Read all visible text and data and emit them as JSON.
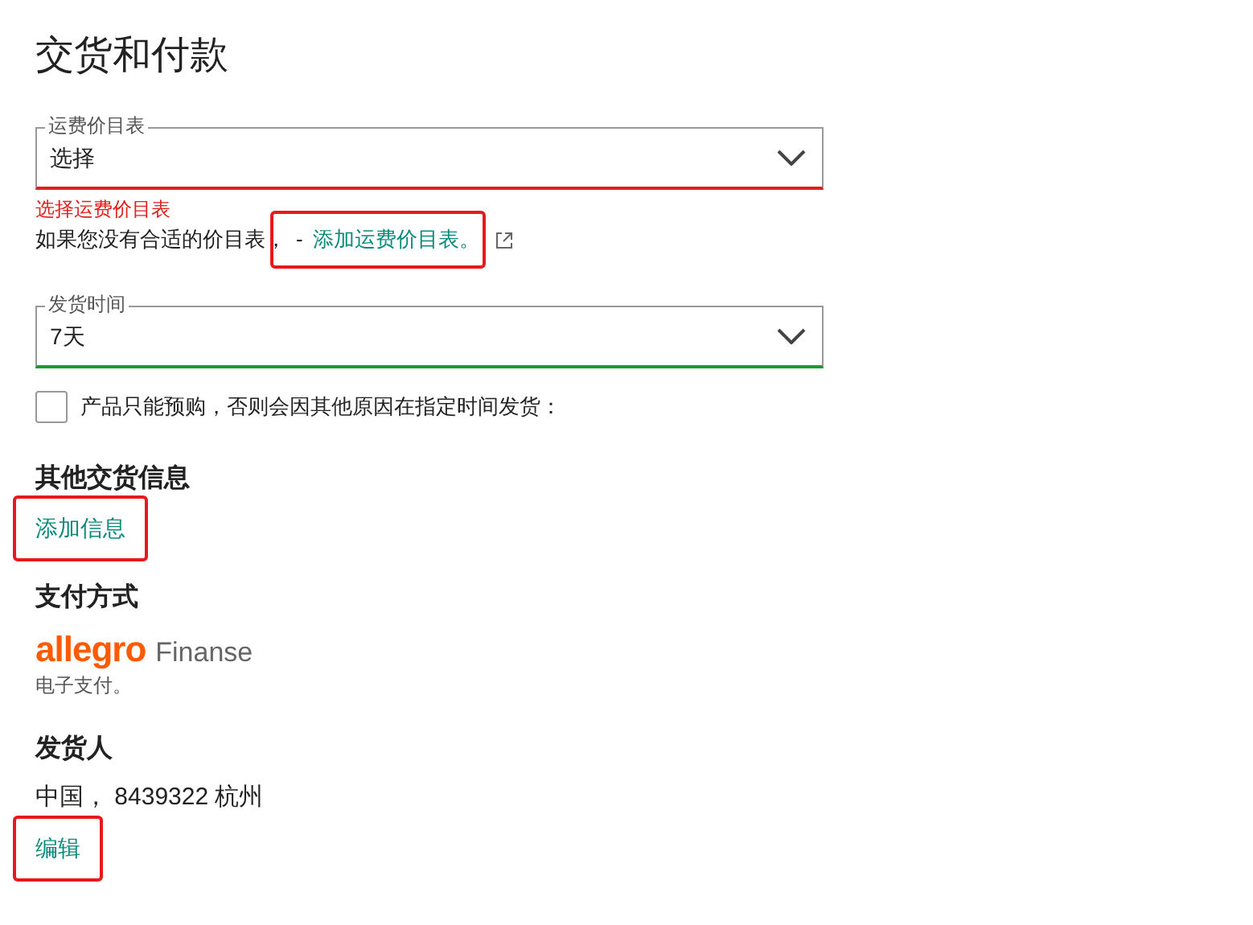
{
  "title": "交货和付款",
  "shipping_price_list": {
    "label": "运费价目表",
    "value": "选择",
    "valid": false,
    "error": "选择运费价目表"
  },
  "help": {
    "text": "如果您没有合适的价目表，",
    "link": {
      "prefix": "-",
      "label": "添加运费价目表。",
      "highlighted": true
    }
  },
  "dispatch_time": {
    "label": "发货时间",
    "value": "7天",
    "valid": true
  },
  "preorder": {
    "label": "产品只能预购，否则会因其他原因在指定时间发货：",
    "checked": false
  },
  "sections": [
    {
      "kind": "link",
      "heading": "其他交货信息",
      "link": {
        "label": "添加信息",
        "highlighted": true
      }
    },
    {
      "kind": "payment",
      "heading": "支付方式",
      "logo": {
        "brand": "allegro",
        "suffix": "Finanse"
      },
      "note": "电子支付。"
    },
    {
      "kind": "address",
      "heading": "发货人",
      "text": "中国， 8439322 杭州",
      "link": {
        "label": "编辑",
        "highlighted": true
      }
    }
  ]
}
